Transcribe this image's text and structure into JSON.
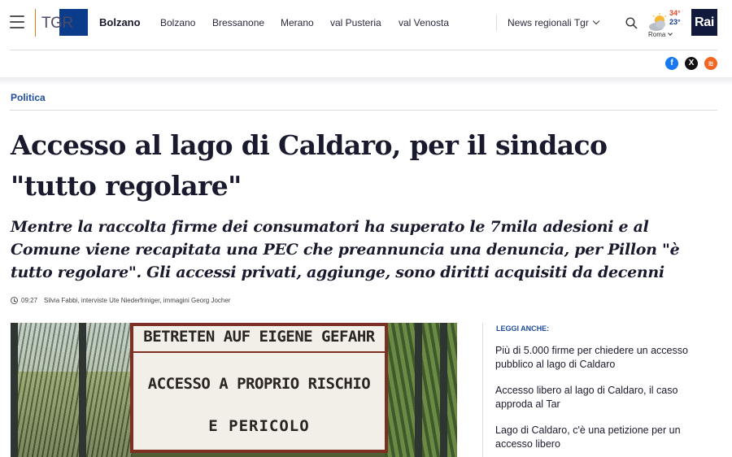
{
  "header": {
    "brand": "TGR",
    "region": "Bolzano",
    "nav_items": [
      "Bolzano",
      "Bressanone",
      "Merano",
      "val Pusteria",
      "val Venosta"
    ],
    "news_dropdown": "News regionali Tgr",
    "weather": {
      "temp_max": "34°",
      "temp_min": "23°",
      "city": "Roma"
    },
    "rai_logo": "Rai",
    "icons": {
      "menu": "hamburger-icon",
      "search": "search-icon",
      "weather": "partly-cloudy-icon"
    }
  },
  "social": [
    {
      "name": "facebook",
      "glyph": "f",
      "color": "#1877f2"
    },
    {
      "name": "x",
      "glyph": "X",
      "color": "#111111"
    },
    {
      "name": "rss",
      "glyph": "≋",
      "color": "#f26522"
    }
  ],
  "article": {
    "category": "Politica",
    "headline": "Accesso al lago di Caldaro, per il sindaco \"tutto regolare\"",
    "subheadline": "Mentre la raccolta firme dei consumatori ha superato le 7mila adesioni e al Comune viene recapitata una PEC che preannuncia una denuncia, per Pillon \"è tutto regolare\". Gli accessi privati, aggiunge, sono diritti acquisiti da decenni",
    "time": "09:27",
    "credits": "Silvia Fabbi, interviste Ute Niederfriniger, immagini Georg Jocher",
    "image_sign": {
      "line1": "BETRETEN AUF EIGENE GEFAHR",
      "line2": "ACCESSO A PROPRIO RISCHIO",
      "line3": "E PERICOLO"
    }
  },
  "related": {
    "title": "LEGGI ANCHE:",
    "items": [
      "Più di 5.000 firme per chiedere un accesso pubblico al lago di Caldaro",
      "Accesso libero al lago di Caldaro, il caso approda al Tar",
      "Lago di Caldaro, c'è una petizione per un accesso libero"
    ]
  },
  "colors": {
    "accent_blue": "#1f4c9a",
    "brand_navy": "#0b3c8c",
    "divider_orange": "#e07a1a",
    "temp_hot": "#e0492a"
  }
}
